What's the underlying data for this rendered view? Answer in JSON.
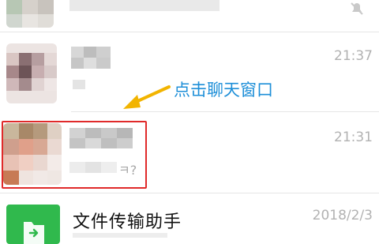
{
  "chat_list": {
    "items": [
      {
        "time": "",
        "muted": true
      },
      {
        "time": "21:37"
      },
      {
        "time": "21:31",
        "message_tail": "ㅋ?"
      },
      {
        "title": "文件传输助手",
        "time": "2018/2/3"
      }
    ]
  },
  "annotation": {
    "text": "点击聊天窗口",
    "color": "#1e8fd8"
  },
  "colors": {
    "highlight_border": "#e02a2a",
    "arrow": "#f2b400",
    "file_transfer_icon": "#30b94d"
  }
}
